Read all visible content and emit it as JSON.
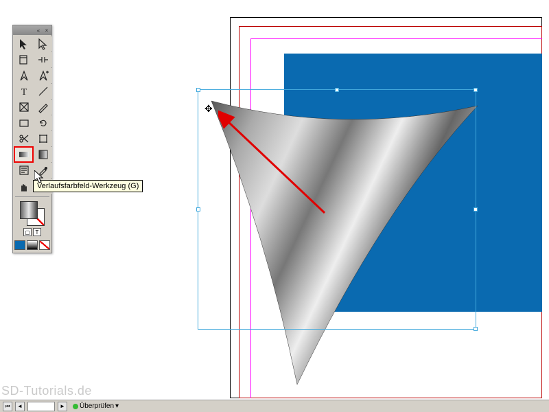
{
  "toolbox": {
    "header_collapse": "«",
    "header_close": "×",
    "tooltip": "Verlaufsfarbfeld-Werkzeug (G)",
    "tools": [
      {
        "name": "selection-tool",
        "icon": "arrow-solid"
      },
      {
        "name": "direct-selection-tool",
        "icon": "arrow-hollow"
      },
      {
        "name": "page-tool",
        "icon": "page"
      },
      {
        "name": "gap-tool",
        "icon": "gap"
      },
      {
        "name": "pen-tool",
        "icon": "pen"
      },
      {
        "name": "add-anchor-tool",
        "icon": "pen-plus"
      },
      {
        "name": "type-tool",
        "icon": "T"
      },
      {
        "name": "line-tool",
        "icon": "line"
      },
      {
        "name": "frame-tool",
        "icon": "frame-x"
      },
      {
        "name": "pencil-tool",
        "icon": "pencil"
      },
      {
        "name": "rectangle-tool",
        "icon": "rect"
      },
      {
        "name": "rotate-tool",
        "icon": "rotate"
      },
      {
        "name": "scissors-tool",
        "icon": "scissors"
      },
      {
        "name": "free-transform-tool",
        "icon": "transform"
      },
      {
        "name": "gradient-swatch-tool",
        "icon": "gradient",
        "highlighted": true
      },
      {
        "name": "gradient-feather-tool",
        "icon": "gradient-box"
      },
      {
        "name": "note-tool",
        "icon": "note"
      },
      {
        "name": "eyedropper-tool",
        "icon": "eyedropper"
      },
      {
        "name": "hand-tool",
        "icon": "hand"
      },
      {
        "name": "zoom-tool",
        "icon": "zoom"
      }
    ],
    "format_t_label": "T",
    "mode_swatches": [
      {
        "name": "apply-color",
        "color": "#0a6ab0"
      },
      {
        "name": "apply-gradient",
        "color": "linear-gradient(#fff,#000)"
      },
      {
        "name": "apply-none",
        "color": "none"
      }
    ]
  },
  "canvas": {
    "blue_rect_color": "#0a6ab0",
    "arrow_color": "#e00000"
  },
  "status_bar": {
    "check_label": "Überprüfen",
    "nav_prev": "◄",
    "nav_next": "►"
  },
  "watermark": "SD-Tutorials.de"
}
